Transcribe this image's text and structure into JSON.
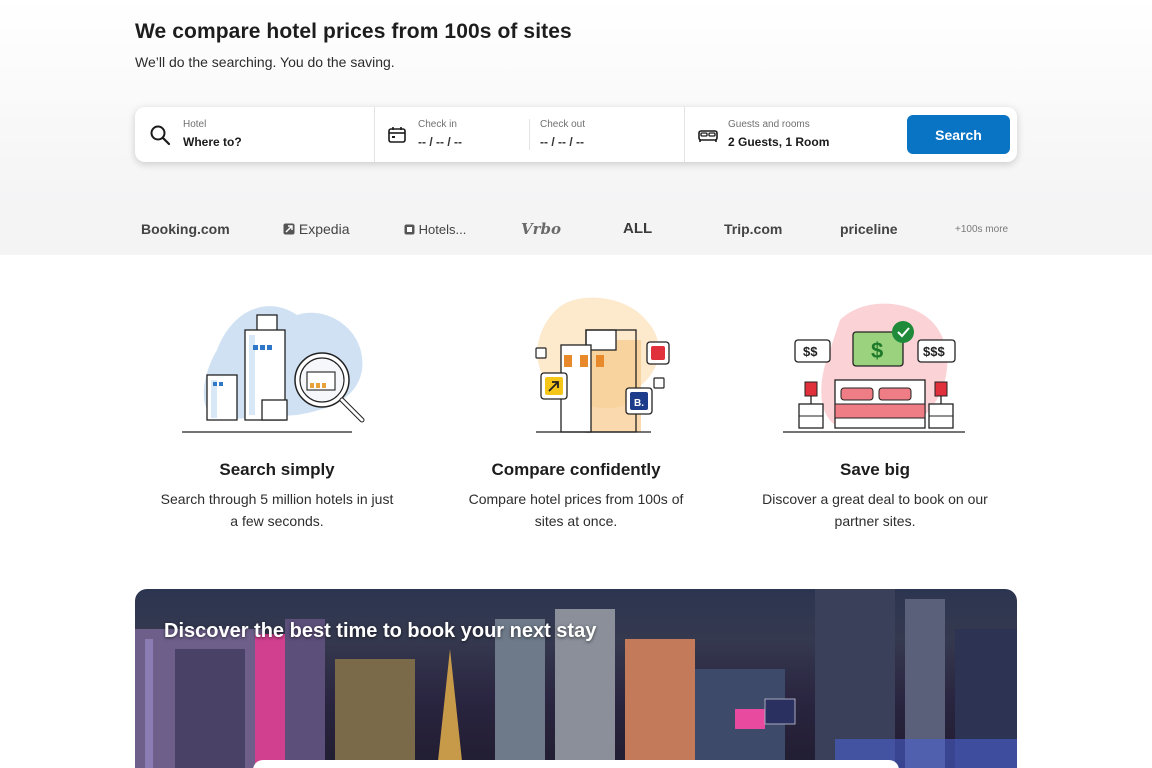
{
  "hero": {
    "title": "We compare hotel prices from 100s of sites",
    "subtitle": "We’ll do the searching. You do the saving."
  },
  "search": {
    "hotel_label": "Hotel",
    "hotel_value": "Where to?",
    "checkin_label": "Check in",
    "checkin_value": "-- / -- / --",
    "checkout_label": "Check out",
    "checkout_value": "-- / -- / --",
    "guests_label": "Guests and rooms",
    "guests_value": "2 Guests, 1 Room",
    "button_label": "Search",
    "accent_color": "#0a74c4"
  },
  "partners": {
    "booking": "Booking.com",
    "expedia": "Expedia",
    "hotels": "Hotels...",
    "vrbo": "Vrbo",
    "all": "ALL",
    "trip": "Trip.com",
    "priceline": "priceline",
    "more": "+100s more"
  },
  "features": [
    {
      "title": "Search simply",
      "description": "Search through 5 million hotels in just a few seconds."
    },
    {
      "title": "Compare confidently",
      "description": "Compare hotel prices from 100s of sites at once."
    },
    {
      "title": "Save big",
      "description": "Discover a great deal to book on our partner sites."
    }
  ],
  "illustrations": {
    "compare_badge_b": "B.",
    "save_price_low": "$$",
    "save_price_mid": "$",
    "save_price_high": "$$$"
  },
  "banner": {
    "title": "Discover the best time to book your next stay"
  }
}
